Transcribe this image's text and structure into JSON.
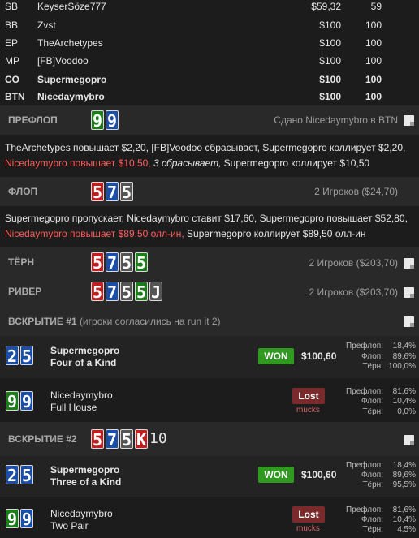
{
  "seats": [
    {
      "pos": "SB",
      "name": "KeyserSöze777",
      "stack": "$59,32",
      "bb": "59",
      "bold": false
    },
    {
      "pos": "BB",
      "name": "Zvst",
      "stack": "$100",
      "bb": "100",
      "bold": false
    },
    {
      "pos": "EP",
      "name": "TheArchetypes",
      "stack": "$100",
      "bb": "100",
      "bold": false
    },
    {
      "pos": "MP",
      "name": "[FB]Voodoo",
      "stack": "$100",
      "bb": "100",
      "bold": false
    },
    {
      "pos": "CO",
      "name": "Supermegopro",
      "stack": "$100",
      "bb": "100",
      "bold": true
    },
    {
      "pos": "BTN",
      "name": "Nicedaymybro",
      "stack": "$100",
      "bb": "100",
      "bold": true
    }
  ],
  "preflop": {
    "label": "ПРЕФЛОП",
    "info": "Сдано Nicedaymybro в BTN",
    "cards": [
      {
        "r": "9",
        "c": "green"
      },
      {
        "r": "9",
        "c": "blue"
      }
    ],
    "line1": "TheArchetypes повышает $2,20, [FB]Voodoo сбрасывает, Supermegopro коллирует $2,20,",
    "line2_hero": "Nicedaymybro повышает $10,50,",
    "line2_folds": " 3 сбрасывает,",
    "line2_rest": " Supermegopro коллирует $10,50"
  },
  "flop": {
    "label": "ФЛОП",
    "info": "2 Игроков ($24,70)",
    "cards": [
      {
        "r": "5",
        "c": "red"
      },
      {
        "r": "7",
        "c": "blue"
      },
      {
        "r": "5",
        "c": "gray"
      }
    ],
    "line1": "Supermegopro пропускает, Nicedaymybro ставит $17,60, Supermegopro повышает $52,80,",
    "line2_hero": "Nicedaymybro повышает $89,50 олл-ин,",
    "line2_rest": " Supermegopro коллирует $89,50 олл-ин"
  },
  "turn": {
    "label": "ТЁРН",
    "info": "2 Игроков ($203,70)",
    "cards": [
      {
        "r": "5",
        "c": "red"
      },
      {
        "r": "7",
        "c": "blue"
      },
      {
        "r": "5",
        "c": "gray"
      },
      {
        "r": "5",
        "c": "green"
      }
    ]
  },
  "river": {
    "label": "РИВЕР",
    "info": "2 Игроков ($203,70)",
    "cards": [
      {
        "r": "5",
        "c": "red"
      },
      {
        "r": "7",
        "c": "blue"
      },
      {
        "r": "5",
        "c": "gray"
      },
      {
        "r": "5",
        "c": "green"
      },
      {
        "r": "J",
        "c": "gray"
      }
    ]
  },
  "showdown1": {
    "label": "ВСКРЫТИЕ #1",
    "note": "(игроки согласились на run it 2)",
    "players": [
      {
        "cards": [
          {
            "r": "2",
            "c": "blue"
          },
          {
            "r": "5",
            "c": "blue"
          }
        ],
        "name": "Supermegopro",
        "hand": "Four of a Kind",
        "result": "WON",
        "amount": "$100,60",
        "eq": [
          {
            "l": "Префлоп:",
            "v": "18,4%"
          },
          {
            "l": "Флоп:",
            "v": "89,6%"
          },
          {
            "l": "Тёрн:",
            "v": "100,0%"
          }
        ]
      },
      {
        "cards": [
          {
            "r": "9",
            "c": "green"
          },
          {
            "r": "9",
            "c": "blue"
          }
        ],
        "name": "Nicedaymybro",
        "hand": "Full House",
        "result": "Lost",
        "sub": "mucks",
        "eq": [
          {
            "l": "Префлоп:",
            "v": "81,6%"
          },
          {
            "l": "Флоп:",
            "v": "10,4%"
          },
          {
            "l": "Тёрн:",
            "v": "0,0%"
          }
        ]
      }
    ]
  },
  "showdown2": {
    "label": "ВСКРЫТИЕ #2",
    "cards": [
      {
        "r": "5",
        "c": "red"
      },
      {
        "r": "7",
        "c": "blue"
      },
      {
        "r": "5",
        "c": "gray"
      },
      {
        "r": "K",
        "c": "red"
      },
      {
        "r": "10",
        "c": "plain"
      }
    ],
    "players": [
      {
        "cards": [
          {
            "r": "2",
            "c": "blue"
          },
          {
            "r": "5",
            "c": "blue"
          }
        ],
        "name": "Supermegopro",
        "hand": "Three of a Kind",
        "result": "WON",
        "amount": "$100,60",
        "eq": [
          {
            "l": "Префлоп:",
            "v": "18,4%"
          },
          {
            "l": "Флоп:",
            "v": "89,6%"
          },
          {
            "l": "Тёрн:",
            "v": "95,5%"
          }
        ]
      },
      {
        "cards": [
          {
            "r": "9",
            "c": "green"
          },
          {
            "r": "9",
            "c": "blue"
          }
        ],
        "name": "Nicedaymybro",
        "hand": "Two Pair",
        "result": "Lost",
        "sub": "mucks",
        "eq": [
          {
            "l": "Префлоп:",
            "v": "81,6%"
          },
          {
            "l": "Флоп:",
            "v": "10,4%"
          },
          {
            "l": "Тёрн:",
            "v": "4,5%"
          }
        ]
      }
    ]
  }
}
